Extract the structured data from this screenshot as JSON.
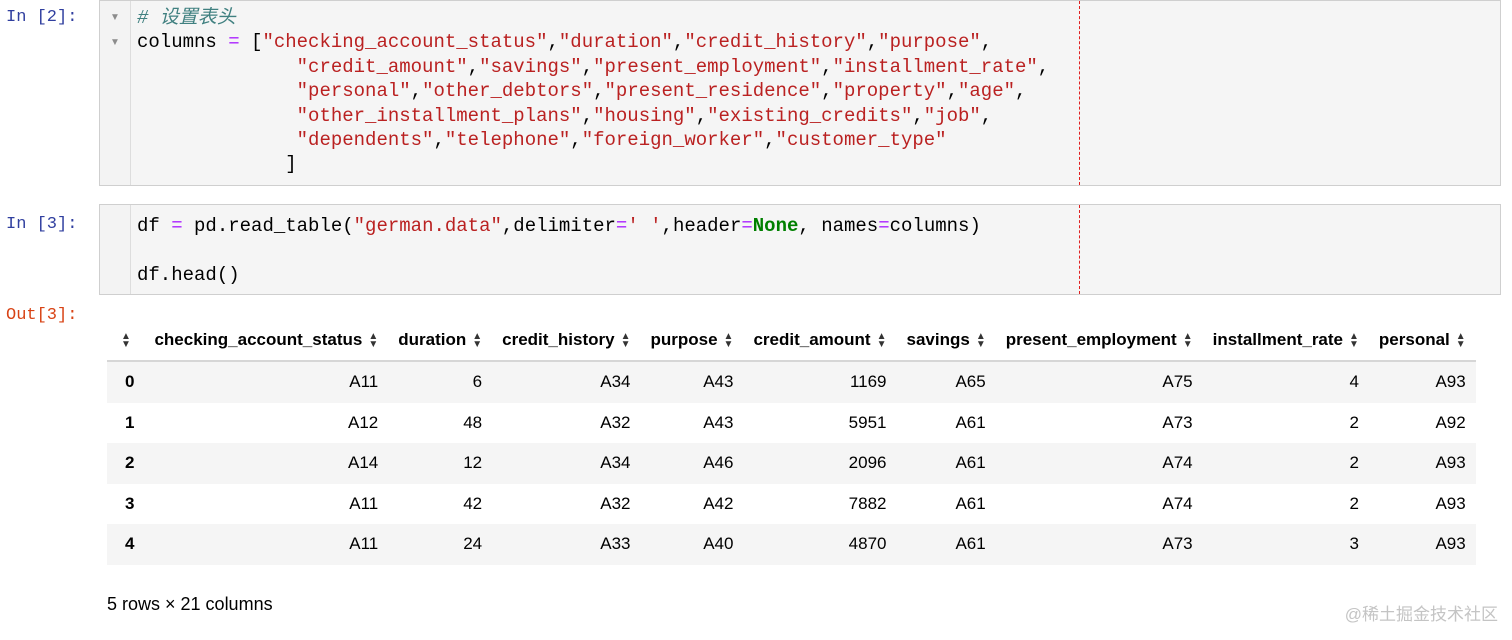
{
  "cells": [
    {
      "prompt": "In [2]:",
      "code_lines": [
        [
          {
            "t": "# 设置表头",
            "c": "cm"
          }
        ],
        [
          {
            "t": "columns "
          },
          {
            "t": "=",
            "c": "op"
          },
          {
            "t": " ["
          },
          {
            "t": "\"checking_account_status\"",
            "c": "s"
          },
          {
            "t": ","
          },
          {
            "t": "\"duration\"",
            "c": "s"
          },
          {
            "t": ","
          },
          {
            "t": "\"credit_history\"",
            "c": "s"
          },
          {
            "t": ","
          },
          {
            "t": "\"purpose\"",
            "c": "s"
          },
          {
            "t": ","
          }
        ],
        [
          {
            "t": "              "
          },
          {
            "t": "\"credit_amount\"",
            "c": "s"
          },
          {
            "t": ","
          },
          {
            "t": "\"savings\"",
            "c": "s"
          },
          {
            "t": ","
          },
          {
            "t": "\"present_employment\"",
            "c": "s"
          },
          {
            "t": ","
          },
          {
            "t": "\"installment_rate\"",
            "c": "s"
          },
          {
            "t": ","
          }
        ],
        [
          {
            "t": "              "
          },
          {
            "t": "\"personal\"",
            "c": "s"
          },
          {
            "t": ","
          },
          {
            "t": "\"other_debtors\"",
            "c": "s"
          },
          {
            "t": ","
          },
          {
            "t": "\"present_residence\"",
            "c": "s"
          },
          {
            "t": ","
          },
          {
            "t": "\"property\"",
            "c": "s"
          },
          {
            "t": ","
          },
          {
            "t": "\"age\"",
            "c": "s"
          },
          {
            "t": ","
          }
        ],
        [
          {
            "t": "              "
          },
          {
            "t": "\"other_installment_plans\"",
            "c": "s"
          },
          {
            "t": ","
          },
          {
            "t": "\"housing\"",
            "c": "s"
          },
          {
            "t": ","
          },
          {
            "t": "\"existing_credits\"",
            "c": "s"
          },
          {
            "t": ","
          },
          {
            "t": "\"job\"",
            "c": "s"
          },
          {
            "t": ","
          }
        ],
        [
          {
            "t": "              "
          },
          {
            "t": "\"dependents\"",
            "c": "s"
          },
          {
            "t": ","
          },
          {
            "t": "\"telephone\"",
            "c": "s"
          },
          {
            "t": ","
          },
          {
            "t": "\"foreign_worker\"",
            "c": "s"
          },
          {
            "t": ","
          },
          {
            "t": "\"customer_type\"",
            "c": "s"
          }
        ],
        [
          {
            "t": "             ]"
          }
        ]
      ]
    },
    {
      "prompt": "In [3]:",
      "code_lines": [
        [
          {
            "t": "df "
          },
          {
            "t": "=",
            "c": "op"
          },
          {
            "t": " pd.read_table("
          },
          {
            "t": "\"german.data\"",
            "c": "s"
          },
          {
            "t": ",delimiter"
          },
          {
            "t": "=",
            "c": "op"
          },
          {
            "t": "' '",
            "c": "s"
          },
          {
            "t": ",header"
          },
          {
            "t": "=",
            "c": "op"
          },
          {
            "t": "None",
            "c": "kw"
          },
          {
            "t": ", names"
          },
          {
            "t": "=",
            "c": "op"
          },
          {
            "t": "columns)"
          }
        ],
        [
          {
            "t": ""
          }
        ],
        [
          {
            "t": "df.head()"
          }
        ]
      ]
    }
  ],
  "output": {
    "prompt": "Out[3]:",
    "table": {
      "columns": [
        "checking_account_status",
        "duration",
        "credit_history",
        "purpose",
        "credit_amount",
        "savings",
        "present_employment",
        "installment_rate",
        "personal"
      ],
      "rows": [
        {
          "index": "0",
          "values": [
            "A11",
            "6",
            "A34",
            "A43",
            "1169",
            "A65",
            "A75",
            "4",
            "A93"
          ]
        },
        {
          "index": "1",
          "values": [
            "A12",
            "48",
            "A32",
            "A43",
            "5951",
            "A61",
            "A73",
            "2",
            "A92"
          ]
        },
        {
          "index": "2",
          "values": [
            "A14",
            "12",
            "A34",
            "A46",
            "2096",
            "A61",
            "A74",
            "2",
            "A93"
          ]
        },
        {
          "index": "3",
          "values": [
            "A11",
            "42",
            "A32",
            "A42",
            "7882",
            "A61",
            "A74",
            "2",
            "A93"
          ]
        },
        {
          "index": "4",
          "values": [
            "A11",
            "24",
            "A33",
            "A40",
            "4870",
            "A61",
            "A73",
            "3",
            "A93"
          ]
        }
      ]
    },
    "shape": "5 rows × 21 columns"
  },
  "watermark": "@稀土掘金技术社区"
}
